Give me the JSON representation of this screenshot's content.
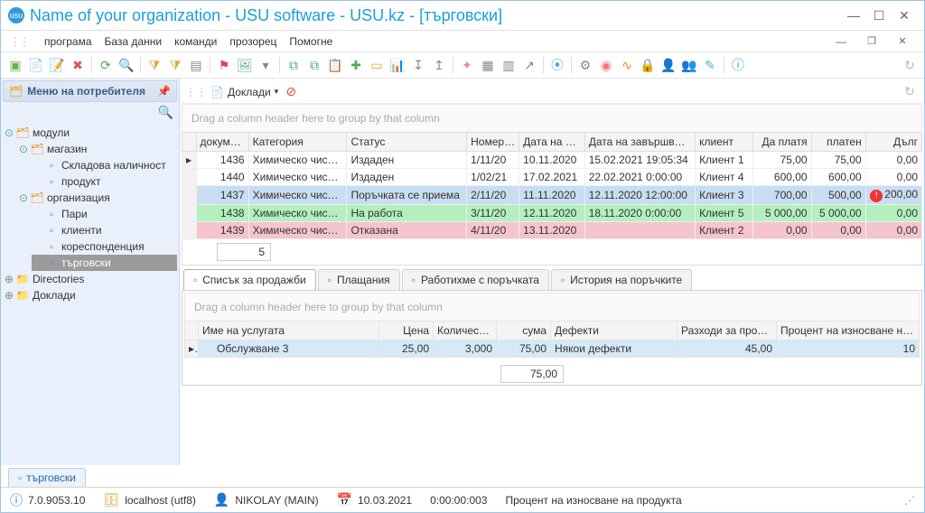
{
  "window": {
    "title": "Name of your organization - USU software - USU.kz - [търговски]"
  },
  "menu": {
    "items": [
      "програма",
      "База данни",
      "команди",
      "прозорец",
      "Помогне"
    ]
  },
  "sidebar": {
    "title": "Меню на потребителя",
    "tree": {
      "modules": "модули",
      "shop": "магазин",
      "stock": "Складова наличност",
      "product": "продукт",
      "org": "организация",
      "money": "Пари",
      "clients": "клиенти",
      "corr": "кореспонденция",
      "trade": "търговски",
      "dirs": "Directories",
      "reports": "Доклади"
    }
  },
  "contentToolbar": {
    "reports": "Доклади"
  },
  "mainGrid": {
    "hint": "Drag a column header here to group by that column",
    "headers": {
      "doc": "докуме…",
      "cat": "Категория",
      "status": "Статус",
      "num": "Номер …",
      "dateP": "Дата на п…",
      "dateEnd": "Дата на завършване",
      "client": "клиент",
      "topay": "Да платя",
      "paid": "платен",
      "debt": "Дълг"
    },
    "rows": [
      {
        "doc": "1436",
        "cat": "Химическо чистене",
        "status": "Издаден",
        "num": "1/11/20",
        "dateP": "10.11.2020",
        "dateEnd": "15.02.2021 19:05:34",
        "client": "Клиент 1",
        "topay": "75,00",
        "paid": "75,00",
        "debt": "0,00",
        "cls": ""
      },
      {
        "doc": "1440",
        "cat": "Химическо чистене",
        "status": "Издаден",
        "num": "1/02/21",
        "dateP": "17.02.2021",
        "dateEnd": "22.02.2021 0:00:00",
        "client": "Клиент 4",
        "topay": "600,00",
        "paid": "600,00",
        "debt": "0,00",
        "cls": ""
      },
      {
        "doc": "1437",
        "cat": "Химическо чистене",
        "status": "Поръчката се приема",
        "num": "2/11/20",
        "dateP": "11.11.2020",
        "dateEnd": "12.11.2020 12:00:00",
        "client": "Клиент 3",
        "topay": "700,00",
        "paid": "500,00",
        "debt": "200,00",
        "cls": "row-blue",
        "warn": true
      },
      {
        "doc": "1438",
        "cat": "Химическо чистене",
        "status": "На работа",
        "num": "3/11/20",
        "dateP": "12.11.2020",
        "dateEnd": "18.11.2020 0:00:00",
        "client": "Клиент 5",
        "topay": "5 000,00",
        "paid": "5 000,00",
        "debt": "0,00",
        "cls": "row-green",
        "greencells": true
      },
      {
        "doc": "1439",
        "cat": "Химическо чистене",
        "status": "Отказана",
        "num": "4/11/20",
        "dateP": "13.11.2020",
        "dateEnd": "",
        "client": "Клиент 2",
        "topay": "0,00",
        "paid": "0,00",
        "debt": "0,00",
        "cls": "row-pink"
      }
    ],
    "count": "5"
  },
  "tabs": {
    "t1": "Списък за продажби",
    "t2": "Плащания",
    "t3": "Работихме с поръчката",
    "t4": "История на поръчките"
  },
  "detailGrid": {
    "hint": "Drag a column header here to group by that column",
    "headers": {
      "name": "Име на услугата",
      "price": "Цена",
      "qty": "Количество",
      "sum": "сума",
      "defects": "Дефекти",
      "prodcost": "Разходи за продукт",
      "wear": "Процент на износване на …"
    },
    "row": {
      "name": "Обслужване 3",
      "price": "25,00",
      "qty": "3,000",
      "sum": "75,00",
      "defects": "Някои дефекти",
      "prodcost": "45,00",
      "wear": "10"
    },
    "sum": "75,00"
  },
  "openTab": "търговски",
  "status": {
    "ver": "7.0.9053.10",
    "host": "localhost (utf8)",
    "user": "NIKOLAY (MAIN)",
    "date": "10.03.2021",
    "time": "0:00:00:003",
    "msg": "Процент на износване на продукта"
  }
}
